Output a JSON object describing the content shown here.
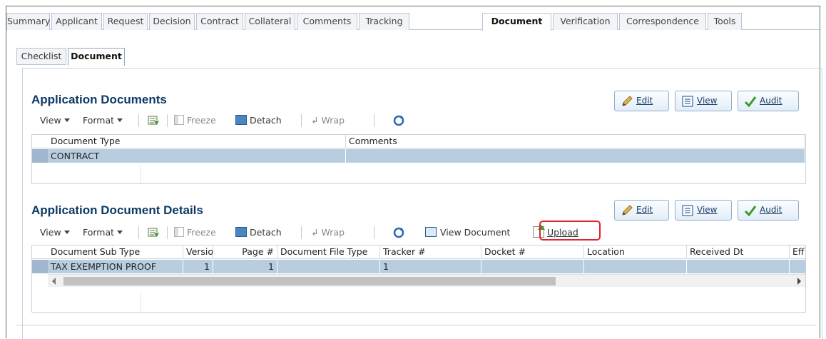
{
  "main_tabs": [
    "Summary",
    "Applicant",
    "Request",
    "Decision",
    "Contract",
    "Collateral",
    "Comments",
    "Tracking",
    "Document",
    "Verification",
    "Correspondence",
    "Tools"
  ],
  "main_tab_active": "Document",
  "sub_tabs": [
    "Checklist",
    "Document"
  ],
  "sub_tab_active": "Document",
  "section1": {
    "title": "Application Documents",
    "buttons": {
      "edit": "Edit",
      "view": "View",
      "audit": "Audit"
    },
    "toolbar": {
      "view": "View",
      "format": "Format",
      "freeze": "Freeze",
      "detach": "Detach",
      "wrap": "Wrap"
    },
    "columns": [
      "Document Type",
      "Comments"
    ],
    "rows": [
      {
        "document_type": "CONTRACT",
        "comments": ""
      }
    ]
  },
  "section2": {
    "title": "Application Document Details",
    "buttons": {
      "edit": "Edit",
      "view": "View",
      "audit": "Audit"
    },
    "toolbar": {
      "view": "View",
      "format": "Format",
      "freeze": "Freeze",
      "detach": "Detach",
      "wrap": "Wrap",
      "view_document": "View Document",
      "upload": "Upload"
    },
    "columns": [
      "Document Sub Type",
      "Versio",
      "Page #",
      "Document File Type",
      "Tracker #",
      "Docket #",
      "Location",
      "Received Dt",
      "Eff"
    ],
    "rows": [
      {
        "sub_type": "TAX EXEMPTION PROOF",
        "version": "1",
        "page": "1",
        "file_type": "",
        "tracker": "1",
        "docket": "",
        "location": "",
        "received": "",
        "eff": ""
      }
    ]
  },
  "colors": {
    "title": "#0e3a66",
    "row_selected": "#b9cde0",
    "highlight": "#e0212e"
  }
}
